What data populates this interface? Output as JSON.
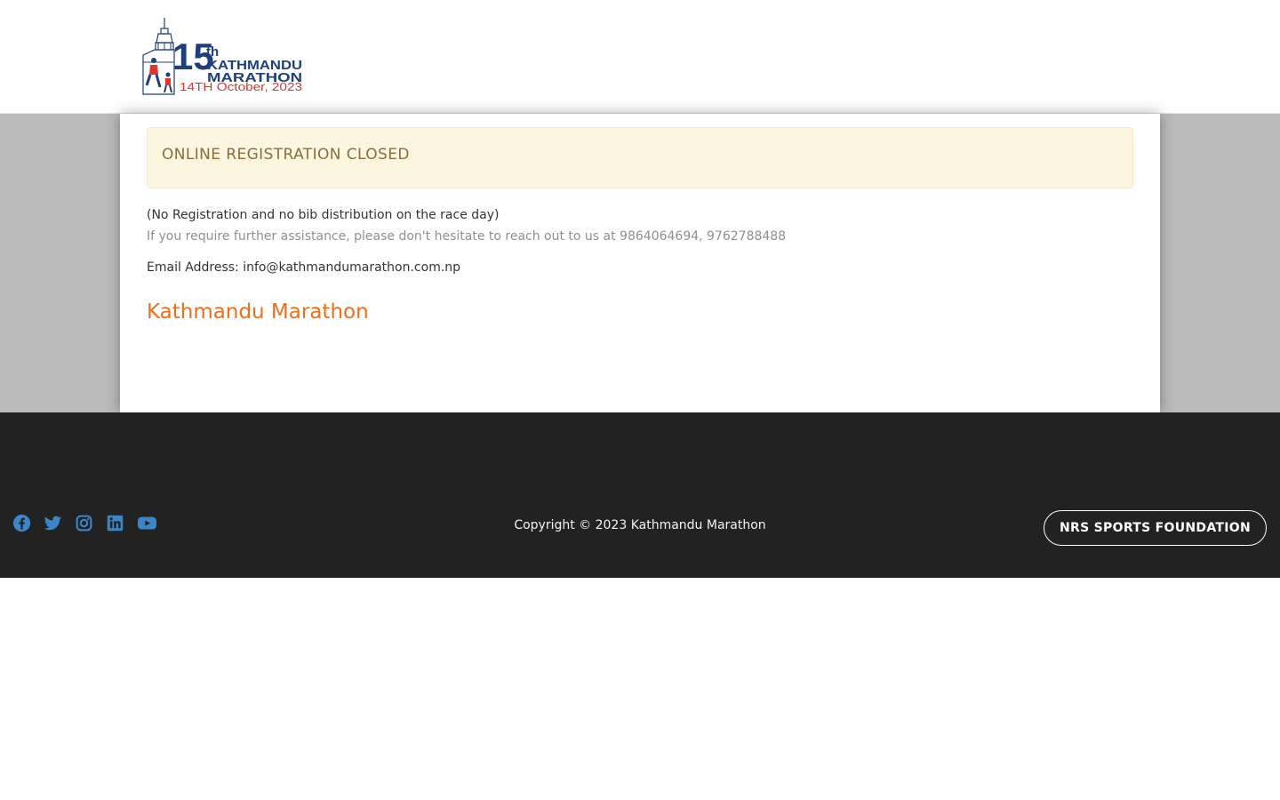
{
  "header": {
    "logo": {
      "number": "15",
      "suffix": "th",
      "line1": "KATHMANDU",
      "line2": "MARATHON",
      "date": "14TH October, 2023"
    }
  },
  "notice": {
    "alert": "ONLINE REGISTRATION CLOSED",
    "line1": "(No Registration and no bib distribution on the race day)",
    "line2": "If you require further assistance, please don't hesitate to reach out to us at 9864064694, 9762788488",
    "email_line": "Email Address: info@kathmandumarathon.com.np",
    "title": "Kathmandu Marathon"
  },
  "footer": {
    "social": [
      "facebook-icon",
      "twitter-icon",
      "instagram-icon",
      "linkedin-icon",
      "youtube-icon"
    ],
    "copyright": "Copyright © 2023 Kathmandu Marathon",
    "button_label": "NRS SPORTS FOUNDATION"
  },
  "colors": {
    "accent": "#f26f1a",
    "social_icon": "#3a86c8",
    "logo_blue": "#1f3f7a",
    "logo_red": "#e2332c",
    "footer_bg": "#222222",
    "alert_bg": "#fcf6e1"
  }
}
